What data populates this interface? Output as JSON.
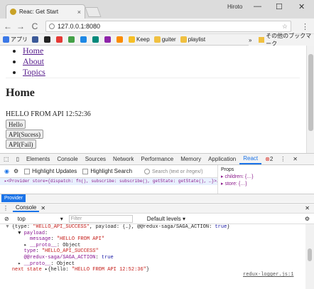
{
  "browser": {
    "tab_title": "Reac: Get Start",
    "tab_close": "×",
    "user_name": "Hiroto",
    "window_controls": [
      "—",
      "☐",
      "✕"
    ],
    "nav": {
      "back": "←",
      "forward": "→",
      "reload": "C"
    },
    "url": "127.0.0.1:8080",
    "star": "☆",
    "menu": "⋮",
    "bookmarks": [
      {
        "label": "アプリ",
        "icon": "apps-icon",
        "color": "#3b78e7"
      },
      {
        "label": "",
        "icon": "bookmark-icon-1",
        "color": "#3b5998"
      },
      {
        "label": "",
        "icon": "github-icon",
        "color": "#222222"
      },
      {
        "label": "",
        "icon": "bookmark-icon-2",
        "color": "#e53935"
      },
      {
        "label": "",
        "icon": "bookmark-icon-3",
        "color": "#43a047"
      },
      {
        "label": "",
        "icon": "bookmark-icon-4",
        "color": "#1e88e5"
      },
      {
        "label": "",
        "icon": "bookmark-icon-5",
        "color": "#00897b"
      },
      {
        "label": "",
        "icon": "bookmark-icon-6",
        "color": "#8e24aa"
      },
      {
        "label": "",
        "icon": "bookmark-icon-7",
        "color": "#fb8c00"
      },
      {
        "label": "Keep",
        "icon": "keep-icon",
        "color": "#f6bf26"
      },
      {
        "label": "guiter",
        "icon": "folder-icon",
        "color": "#f0c040"
      },
      {
        "label": "playlist",
        "icon": "folder-icon",
        "color": "#f0c040"
      }
    ],
    "bookmark_more": "»",
    "other_bookmarks": "その他のブックマーク"
  },
  "page": {
    "nav_links": [
      "Home",
      "About",
      "Topics"
    ],
    "heading": "Home",
    "message": "HELLO FROM API 12:52:36",
    "buttons": [
      "Hello",
      "API(Sucess)",
      "API(Fail)"
    ]
  },
  "devtools": {
    "tabs": [
      "Elements",
      "Console",
      "Sources",
      "Network",
      "Performance",
      "Memory",
      "Application",
      "React"
    ],
    "active_tab": "React",
    "error_count": "2",
    "react": {
      "highlight_updates": "Highlight Updates",
      "highlight_search": "Highlight Search",
      "search_placeholder": "Search (text or /regex/)",
      "tree_line": "▸<Provider store={dispatch: fn(), subscribe: subscribe(), getState: getState(), …}>…</Provider>",
      "props_title": "Props",
      "props": [
        "▸ children: {…}",
        "▸ store: {…}"
      ],
      "breadcrumb": "Provider"
    },
    "console": {
      "title": "Console",
      "context": "top",
      "filter_placeholder": "Filter",
      "levels": "Default levels ▾",
      "lines": [
        {
          "parts": [
            [
              "g",
              "  ▼ "
            ],
            [
              "",
              "{type: "
            ],
            [
              "s",
              "\"HELLO_API_SUCCESS\""
            ],
            [
              "",
              ", payload: {…}, @@redux-saga/SAGA_ACTION: "
            ],
            [
              "n",
              "true"
            ],
            [
              "",
              "}"
            ]
          ]
        },
        {
          "parts": [
            [
              "",
              "      ▼ "
            ],
            [
              "k",
              "payload"
            ],
            [
              "",
              ":"
            ]
          ]
        },
        {
          "parts": [
            [
              "",
              "          "
            ],
            [
              "k",
              "message"
            ],
            [
              "",
              ": "
            ],
            [
              "s",
              "\"HELLO FROM API\""
            ]
          ]
        },
        {
          "parts": [
            [
              "",
              "        ▸ "
            ],
            [
              "k",
              "__proto__"
            ],
            [
              "",
              ": Object"
            ]
          ]
        },
        {
          "parts": [
            [
              "",
              "        "
            ],
            [
              "k",
              "type"
            ],
            [
              "",
              ": "
            ],
            [
              "s",
              "\"HELLO_API_SUCCESS\""
            ]
          ]
        },
        {
          "parts": [
            [
              "",
              "        "
            ],
            [
              "k",
              "@@redux-saga/SAGA_ACTION"
            ],
            [
              "",
              ": "
            ],
            [
              "n",
              "true"
            ]
          ]
        },
        {
          "parts": [
            [
              "",
              "      ▸ "
            ],
            [
              "k",
              "__proto__"
            ],
            [
              "",
              ": Object"
            ]
          ]
        },
        {
          "parts": [
            [
              "",
              "    "
            ],
            [
              "s",
              "next state"
            ],
            [
              "",
              " ▸{hello: "
            ],
            [
              "s",
              "\"HELLO FROM API 12:52:36\""
            ],
            [
              "",
              "}"
            ]
          ]
        }
      ],
      "source_link": "redux-logger.js:1"
    }
  }
}
